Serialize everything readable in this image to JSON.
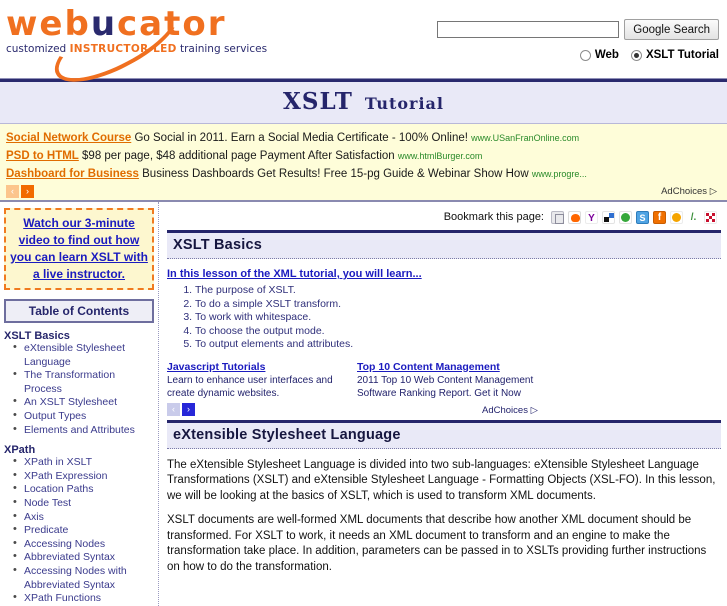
{
  "header": {
    "logo": {
      "part1": "web",
      "part2": "u",
      "part3": "cator",
      "sub1": "customized ",
      "sub2": "INSTRUCTOR-LED",
      "sub3": " training services"
    },
    "search": {
      "value": "",
      "placeholder": "",
      "button_label": "Google Search",
      "option_web": "Web",
      "option_site": "XSLT Tutorial",
      "selected": "XSLT Tutorial"
    }
  },
  "banner": {
    "title_primary": "XSLT",
    "title_secondary": "Tutorial"
  },
  "top_ads": {
    "ads": [
      {
        "title": "Social Network Course",
        "desc": "Go Social in 2011. Earn a Social Media Certificate - 100% Online!",
        "url": "www.USanFranOnline.com"
      },
      {
        "title": "PSD to HTML",
        "desc": "$98 per page, $48 additional page Payment After Satisfaction",
        "url": "www.htmlBurger.com"
      },
      {
        "title": "Dashboard for Business",
        "desc": "Business Dashboards Get Results! Free 15-pg Guide & Webinar Show How",
        "url": "www.progre..."
      }
    ],
    "prev_label": "‹",
    "next_label": "›",
    "adchoices_label": "AdChoices"
  },
  "sidebar": {
    "promo": "Watch our 3-minute video to find out how you can learn XSLT with a live instructor.",
    "toc_button": "Table of Contents",
    "groups": [
      {
        "title": "XSLT Basics",
        "items": [
          "eXtensible Stylesheet Language",
          "The Transformation Process",
          "An XSLT Stylesheet",
          "Output Types",
          "Elements and Attributes"
        ]
      },
      {
        "title": "XPath",
        "items": [
          "XPath in XSLT",
          "XPath Expression",
          "Location Paths",
          "Node Test",
          "Axis",
          "Predicate",
          "Accessing Nodes",
          "Abbreviated Syntax",
          "Accessing Nodes with Abbreviated Syntax",
          "XPath Functions"
        ]
      }
    ]
  },
  "bookmark": {
    "label": "Bookmark this page:",
    "icons": [
      "delicious-icon",
      "reddit-icon",
      "yahoo-buzz-icon",
      "windows-live-icon",
      "technorati-icon",
      "stumbleupon-icon",
      "facebook-icon",
      "orange-bookmark-icon",
      "slashdot-icon",
      "qrcode-icon"
    ]
  },
  "main": {
    "section1_title": "XSLT Basics",
    "lesson_link": "In this lesson of the XML tutorial, you will learn...",
    "objectives": [
      "The purpose of XSLT.",
      "To do a simple XSLT transform.",
      "To work with whitespace.",
      "To choose the output mode.",
      "To output elements and attributes."
    ],
    "inline_ads": [
      {
        "title": "Javascript Tutorials",
        "desc": "Learn to enhance user interfaces and create dynamic websites."
      },
      {
        "title": "Top 10 Content Management",
        "desc": "2011 Top 10 Web Content Management Software Ranking Report. Get it Now"
      }
    ],
    "inline_prev": "‹",
    "inline_next": "›",
    "inline_adchoices": "AdChoices",
    "section2_title": "eXtensible Stylesheet Language",
    "paragraph1": "The eXtensible Stylesheet Language is divided into two sub-languages: eXtensible Stylesheet Language Transformations (XSLT) and eXtensible Stylesheet Language - Formatting Objects (XSL-FO). In this lesson, we will be looking at the basics of XSLT, which is used to transform XML documents.",
    "paragraph2": "XSLT documents are well-formed XML documents that describe how another XML document should be transformed. For XSLT to work, it needs an XML document to transform and an engine to make the transformation take place. In addition, parameters can be passed in to XSLTs providing further instructions on how to do the transformation."
  },
  "colors": {
    "brand_orange": "#f07020",
    "brand_navy": "#25256b",
    "ad_background": "#fefdd9",
    "banner_background": "#e9e9f7",
    "link_blue": "#1b1bbf",
    "ad_url_green": "#2a8a2a"
  }
}
